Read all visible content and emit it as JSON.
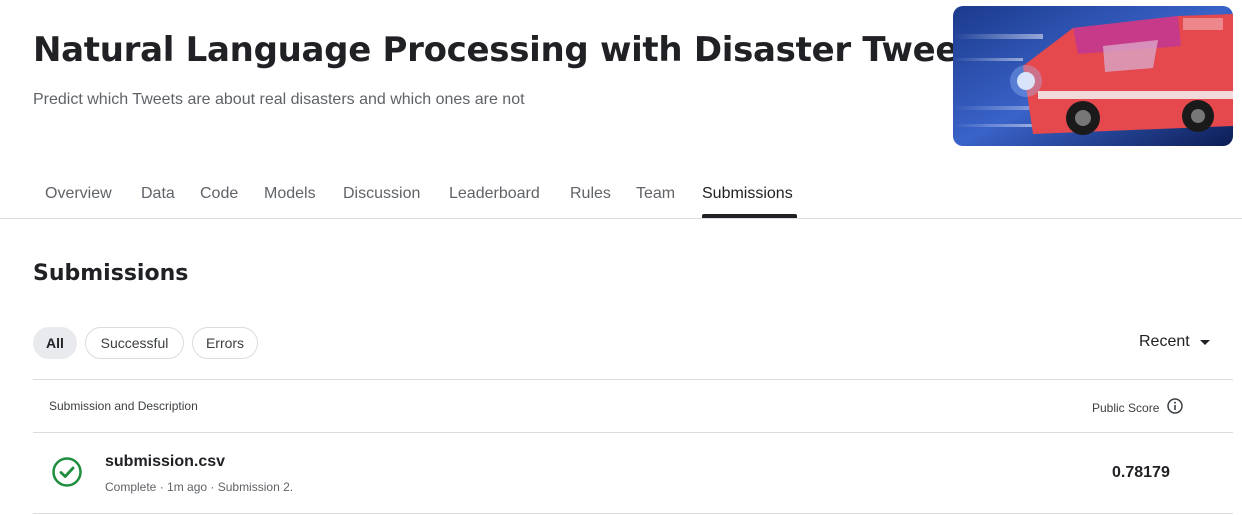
{
  "header": {
    "title": "Natural Language Processing with Disaster Tweets",
    "subtitle": "Predict which Tweets are about real disasters and which ones are not"
  },
  "tabs": [
    {
      "label": "Overview"
    },
    {
      "label": "Data"
    },
    {
      "label": "Code"
    },
    {
      "label": "Models"
    },
    {
      "label": "Discussion"
    },
    {
      "label": "Leaderboard"
    },
    {
      "label": "Rules"
    },
    {
      "label": "Team"
    },
    {
      "label": "Submissions",
      "active": true
    }
  ],
  "section": {
    "title": "Submissions"
  },
  "filters": [
    {
      "label": "All",
      "selected": true
    },
    {
      "label": "Successful"
    },
    {
      "label": "Errors"
    }
  ],
  "sort": {
    "label": "Recent"
  },
  "table": {
    "col_description": "Submission and Description",
    "col_score": "Public Score",
    "rows": [
      {
        "file": "submission.csv",
        "status": "Complete",
        "time": "1m ago",
        "description": "Submission 2.",
        "meta": "Complete · 1m ago · Submission 2.",
        "score": "0.78179",
        "status_icon": "check-circle-icon",
        "status_color": "#1e8e3e"
      }
    ]
  },
  "colors": {
    "text_primary": "#202124",
    "text_secondary": "#5f6368",
    "divider": "#dadce0",
    "success": "#1e8e3e"
  }
}
